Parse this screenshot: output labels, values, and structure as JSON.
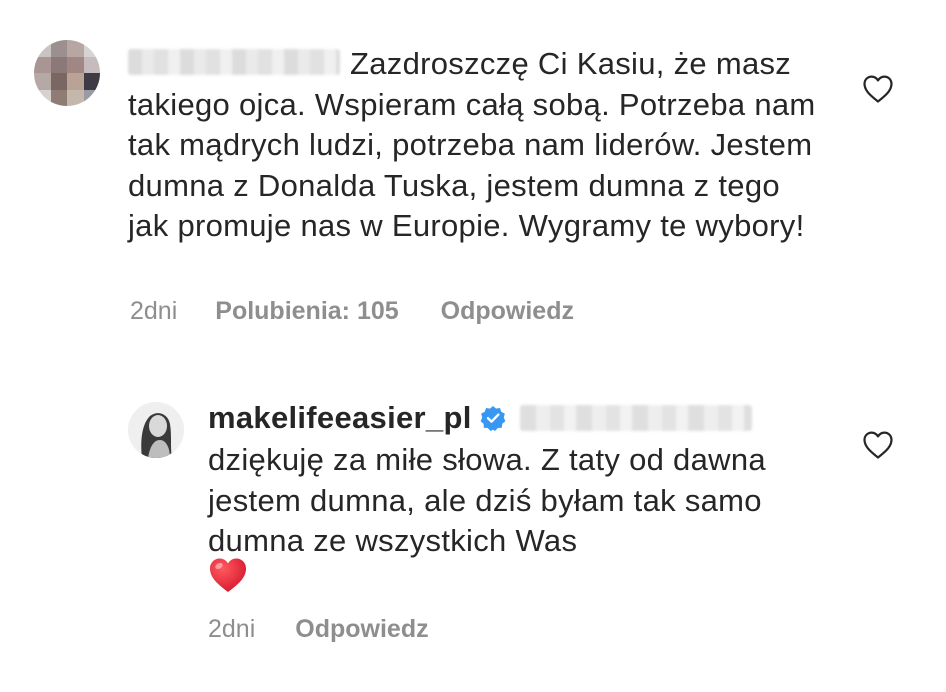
{
  "comments": [
    {
      "username_hidden": true,
      "text": "Zazdroszczę Ci Kasiu, że masz takiego ojca. Wspieram całą sobą. Potrzeba nam tak mądrych ludzi, potrzeba nam liderów. Jestem dumna z Donalda Tuska, jestem dumna z tego jak promuje nas w Europie. Wygramy te wybory!",
      "time": "2dni",
      "likes": "Polubienia: 105",
      "reply_label": "Odpowiedz",
      "icons": {
        "avatar": "pixelated-avatar",
        "like": "heart-outline-icon"
      }
    },
    {
      "username": "makelifeeasier_pl",
      "verified": true,
      "mention_hidden": true,
      "text": "dziękuję za miłe słowa. Z taty od dawna jestem dumna, ale dziś byłam tak samo dumna ze wszystkich Was",
      "emoji": "red-heart-emoji",
      "time": "2dni",
      "reply_label": "Odpowiedz",
      "icons": {
        "avatar": "profile-avatar",
        "like": "heart-outline-icon",
        "badge": "verified-badge-icon"
      }
    }
  ],
  "colors": {
    "text": "#262626",
    "meta": "#8e8e8e",
    "verified": "#3897f0",
    "heart_emoji": "#e0242f"
  }
}
